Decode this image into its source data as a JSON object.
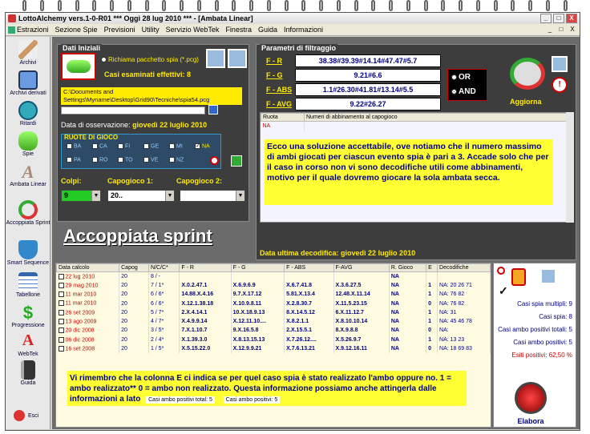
{
  "window": {
    "title": "LottoAlchemy vers.1-0-R01   ***   Oggi 28 lug 2010   ***   - [Ambata Linear]",
    "min": "_",
    "max": "□",
    "close": "X"
  },
  "menu": [
    "Estrazioni",
    "Sezione Spie",
    "Previsioni",
    "Utility",
    "Servizio WebTek",
    "Finestra",
    "Guida",
    "Informazioni"
  ],
  "sidebar": [
    "Archivi",
    "Archivi derivati",
    "Ritardi",
    "Spie",
    "Ambata Linear",
    "Accoppiata Sprint",
    "Smart Sequence",
    "Tabellone",
    "Progressione",
    "WebTek",
    "Guida",
    "Esci"
  ],
  "dati": {
    "title": "Dati Iniziali",
    "richiama": "Richiama pacchetto spia (*.pcg)",
    "casi": "Casi esaminati effettivi: 8",
    "path": "C:\\Documents and Settings\\Myname\\Desktop\\Grid90\\Tecniche\\spia54.pcg",
    "data_label": "Data di osservazione:",
    "data_value": "giovedì 22 luglio 2010",
    "ruote_title": "RUOTE DI GIOCO",
    "ruote_row1": [
      "BA",
      "CA",
      "FI",
      "GE",
      "MI",
      "NA"
    ],
    "ruote_row2": [
      "PA",
      "RO",
      "TO",
      "VE",
      "NZ"
    ],
    "colpi_label": "Colpi:",
    "colpi_value": "9",
    "capo1_label": "Capogioco 1:",
    "capo1_value": "20..",
    "capo2_label": "Capogioco 2:",
    "capo2_value": ""
  },
  "parametri": {
    "title": "Parametri di filtraggio",
    "rows": [
      {
        "label": "F - R",
        "value": "38.38#39.39#14.14#47.47#5.7"
      },
      {
        "label": "F - G",
        "value": "9.21#6.6"
      },
      {
        "label": "F - ABS",
        "value": "1.1#26.30#41.81#13.14#5.5"
      },
      {
        "label": "F - AVG",
        "value": "9.22#26.27"
      }
    ],
    "or": "OR",
    "and": "AND",
    "aggiorna": "Aggiorna",
    "grid_headers": [
      "Ruota",
      "Numeri di abbinamento al capogioco"
    ],
    "grid_first": "NA",
    "note": "Ecco una soluzione accettabile, ove notiamo che il numero massimo di ambi giocati per ciascun evento spia è pari a 3. Accade solo che per il caso in corso non vi sono decodifiche utili come abbinamenti, motivo per il quale dovremo giocare la sola ambata secca.",
    "ultima_label": "Data ultima decodifica:",
    "ultima_value": "giovedì 22 luglio 2010"
  },
  "section_title": "Accoppiata sprint",
  "table": {
    "headers": [
      "Data calcolo",
      "Capog",
      "N/C/C*",
      "F - R",
      "F - G",
      "F - ABS",
      "F-AVG",
      "R. Gioco",
      "E",
      "Decodifiche"
    ],
    "rows": [
      [
        "22 lug 2010",
        "20",
        "8 / -",
        "",
        "",
        "",
        "",
        "NA",
        "",
        ""
      ],
      [
        "29 mag 2010",
        "20",
        "7 / 1*",
        "X.0.2.47.1",
        "X.6.9.6.9",
        "X.6.7.41.8",
        "X.3.6.27.5",
        "NA",
        "1",
        "NA: 20 26 71"
      ],
      [
        "11 mar 2010",
        "20",
        "6 / 6*",
        "14.88.X.4.16",
        "9.7.X.17.12",
        "5.81.X.13.4",
        "12.48.X.11.14",
        "NA",
        "1",
        "NA: 76 82"
      ],
      [
        "11 mar 2010",
        "20",
        "6 / 6*",
        "X.12.1.38.18",
        "X.10.9.8.11",
        "X.2.8.30.7",
        "X.11.5.23.15",
        "NA",
        "0",
        "NA: 76 82"
      ],
      [
        "26 set 2009",
        "20",
        "5 / 7*",
        "2.X.4.14.1",
        "10.X.18.9.13",
        "8.X.14.5.12",
        "6.X.11.12.7",
        "NA",
        "1",
        "NA: 31"
      ],
      [
        "13 ago 2009",
        "20",
        "4 / 7*",
        "X.4.9.9.14",
        "X.12.11.10....",
        "X.8.2.1.1",
        "X.8.10.10.14",
        "NA",
        "1",
        "NA: 45 46 78"
      ],
      [
        "20 dic 2008",
        "20",
        "3 / 5*",
        "7.X.1.10.7",
        "9.X.16.5.8",
        "2.X.15.5.1",
        "8.X.9.8.8",
        "NA",
        "0",
        "NA:"
      ],
      [
        "06 dic 2008",
        "20",
        "2 / 4*",
        "X.1.39.3.0",
        "X.8.13.15.13",
        "X.7.26.12....",
        "X.5.26.9.7",
        "NA",
        "1",
        "NA: 13 23"
      ],
      [
        "16 set 2008",
        "20",
        "1 / 5*",
        "X.5.15.22.0",
        "X.12.9.9.21",
        "X.7.6.13.21",
        "X.9.12.16.11",
        "NA",
        "0",
        "NA: 18 69 83"
      ]
    ],
    "note": "Vi rimembro che la colonna E ci indica se per quel caso spia è stato realizzato l'ambo oppure no. 1 = ambo realizzato** 0 = ambo non realizzato. Questa informazione possiamo anche attingerla dalle informazioni a lato",
    "tag1": "Casi ambo positivi total: 5",
    "tag2": "Casi ambo positivi: 5"
  },
  "stats": {
    "multipli": "Casi spia multipli: 9",
    "spia": "Casi spia: 8",
    "totali": "Casi ambo positivi totali: 5",
    "positivi": "Casi ambo positivi: 5",
    "esiti": "Esiti positivi: 62,50 %",
    "elabora": "Elabora"
  }
}
